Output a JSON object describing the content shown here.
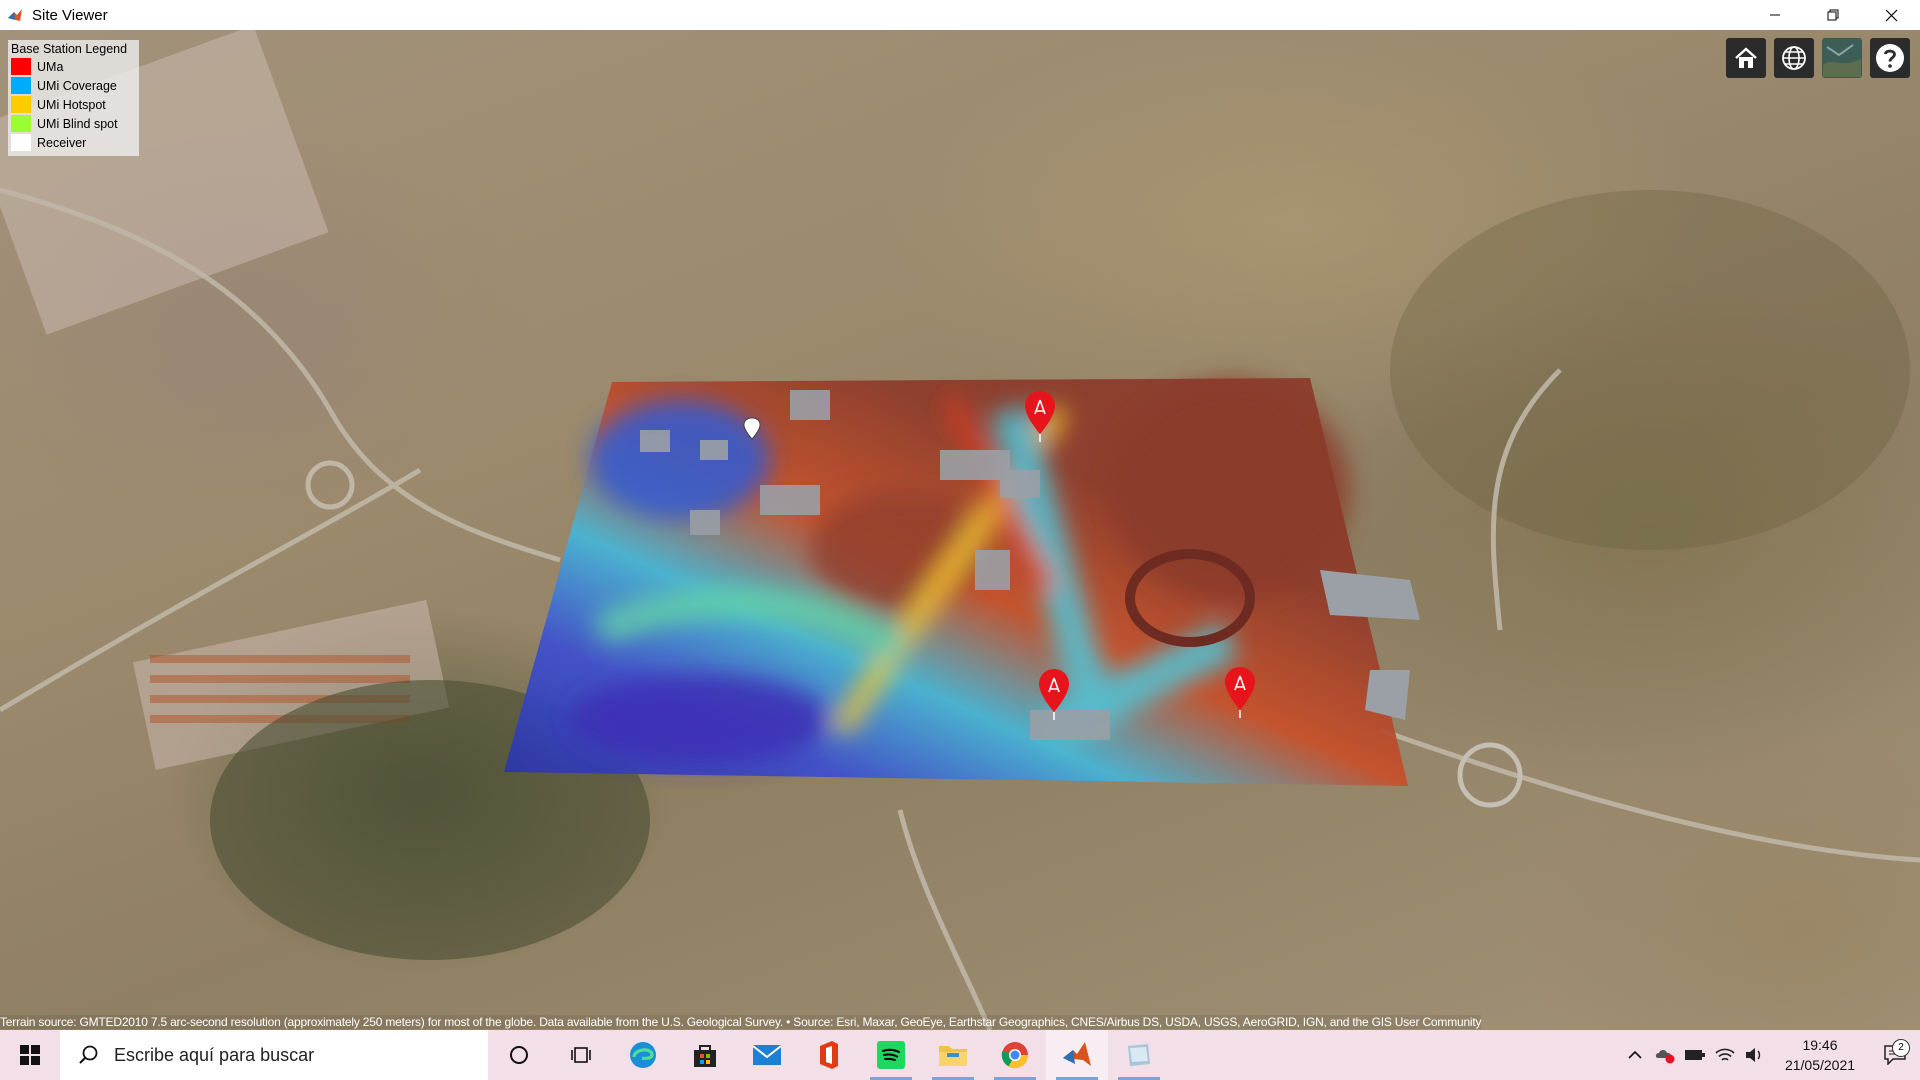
{
  "window": {
    "title": "Site Viewer",
    "controls": {
      "minimize": "—",
      "restore": "❐",
      "close": "✕"
    }
  },
  "legend": {
    "title": "Base Station Legend",
    "items": [
      {
        "label": "UMa",
        "color": "#ff0000"
      },
      {
        "label": "UMi Coverage",
        "color": "#00aaff"
      },
      {
        "label": "UMi Hotspot",
        "color": "#ffcc00"
      },
      {
        "label": "UMi Blind spot",
        "color": "#99ff33"
      },
      {
        "label": "Receiver",
        "color": "#ffffff"
      }
    ]
  },
  "map_tools": [
    "home-icon",
    "globe-icon",
    "basemap-icon",
    "help-icon"
  ],
  "markers": [
    {
      "name": "base-station-marker",
      "color": "#e8141b"
    },
    {
      "name": "base-station-marker",
      "color": "#e8141b"
    },
    {
      "name": "base-station-marker",
      "color": "#e8141b"
    },
    {
      "name": "receiver-marker",
      "color": "#ffffff"
    }
  ],
  "attribution": "Terrain source: GMTED2010 7.5 arc-second resolution (approximately 250 meters) for most of the globe. Data available from the U.S. Geological Survey. • Source: Esri, Maxar, GeoEye, Earthstar Geographics, CNES/Airbus DS, USDA, USGS, AeroGRID, IGN, and the GIS User Community",
  "taskbar": {
    "search_placeholder": "Escribe aquí para buscar",
    "apps": [
      "cortana-icon",
      "task-view-icon",
      "edge-icon",
      "store-icon",
      "mail-icon",
      "office-icon",
      "spotify-icon",
      "file-explorer-icon",
      "chrome-icon",
      "matlab-icon",
      "generic-app-icon"
    ],
    "time": "19:46",
    "date": "21/05/2021",
    "notifications": "2"
  }
}
